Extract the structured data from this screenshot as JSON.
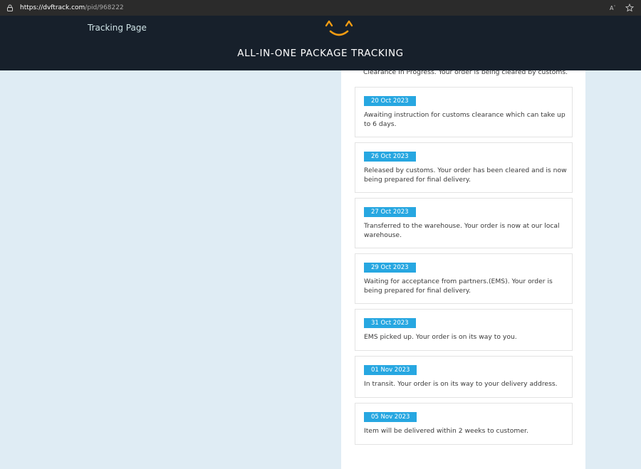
{
  "browser": {
    "url_host": "https://dvftrack.com",
    "url_path": "/pid/968222"
  },
  "header": {
    "nav_link": "Tracking Page",
    "title": "ALL-IN-ONE PACKAGE TRACKING",
    "logo_icon": "smile-icon",
    "logo_color": "#f39c12",
    "background": "#17202b"
  },
  "tracking": {
    "partial_event_text": "Clearance In Progress. Your order is being cleared by customs.",
    "events": [
      {
        "date": "20 Oct 2023",
        "text": "Awaiting instruction for customs clearance which can take up to 6 days."
      },
      {
        "date": "26 Oct 2023",
        "text": "Released by customs. Your order has been cleared and is now being prepared for final delivery."
      },
      {
        "date": "27 Oct 2023",
        "text": "Transferred to the warehouse. Your order is now at our local warehouse."
      },
      {
        "date": "29 Oct 2023",
        "text": "Waiting for acceptance from partners.(EMS). Your order is being prepared for final delivery."
      },
      {
        "date": "31 Oct 2023",
        "text": "EMS picked up. Your order is on its way to you."
      },
      {
        "date": "01 Nov 2023",
        "text": "In transit. Your order is on its way to your delivery address."
      },
      {
        "date": "05 Nov 2023",
        "text": "Item will be delivered within 2 weeks to customer."
      }
    ],
    "badge_color": "#27a7e1"
  }
}
